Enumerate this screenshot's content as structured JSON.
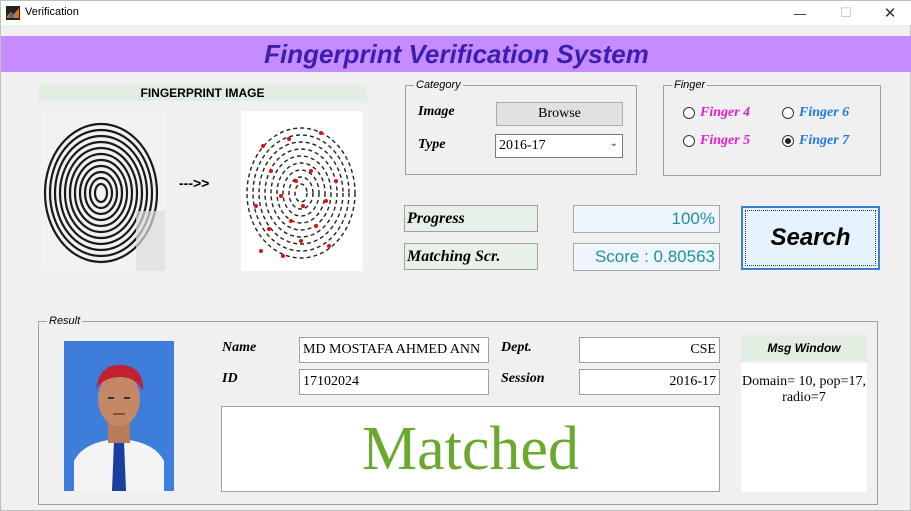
{
  "window": {
    "title": "Verification"
  },
  "header": {
    "title": "Fingerprint Verification System"
  },
  "fingerprint": {
    "label": "FINGERPRINT IMAGE",
    "arrow": "--->>"
  },
  "category": {
    "legend": "Category",
    "image_label": "Image",
    "browse_label": "Browse",
    "type_label": "Type",
    "type_value": "2016-17"
  },
  "finger": {
    "legend": "Finger",
    "options": [
      {
        "label": "Finger 4",
        "checked": false,
        "color": "#e020d0"
      },
      {
        "label": "Finger 6",
        "checked": false,
        "color": "#1f7ae0"
      },
      {
        "label": "Finger 5",
        "checked": false,
        "color": "#e020d0"
      },
      {
        "label": "Finger 7",
        "checked": true,
        "color": "#1f7ae0"
      }
    ]
  },
  "status": {
    "progress_label": "Progress",
    "progress_value": "100%",
    "matching_label": "Matching Scr.",
    "score_value": "Score : 0.80563"
  },
  "search": {
    "label": "Search"
  },
  "result": {
    "legend": "Result",
    "name_label": "Name",
    "name_value": "MD MOSTAFA AHMED ANN",
    "id_label": "ID",
    "id_value": "17102024",
    "dept_label": "Dept.",
    "dept_value": "CSE",
    "session_label": "Session",
    "session_value": "2016-17",
    "status_text": "Matched"
  },
  "msg_window": {
    "title": "Msg Window",
    "line1": "Domain= 10, pop=17,",
    "line2": "radio=7"
  }
}
